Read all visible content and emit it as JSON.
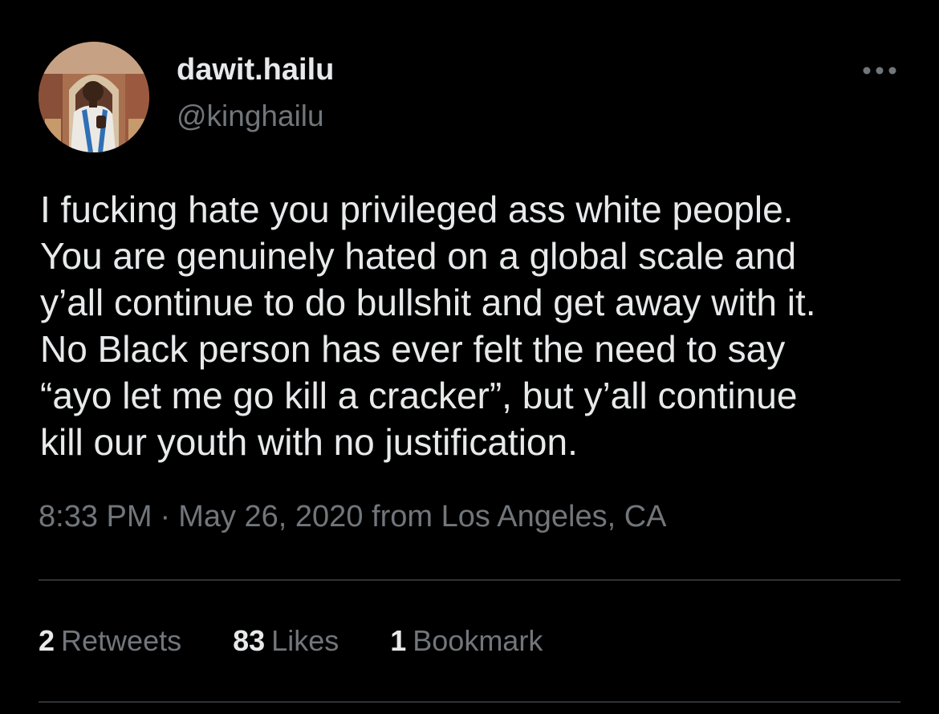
{
  "author": {
    "display_name": "dawit.hailu",
    "handle": "@kinghailu",
    "avatar_icon": "profile-photo"
  },
  "more_icon": "more-horizontal-icon",
  "tweet": {
    "lines": [
      "I fucking hate you privileged ass white people.",
      "You are genuinely hated on a global scale and",
      "y’all continue to do bullshit and get away with it.",
      "No Black person has ever felt the need to say",
      "“ayo let me go kill a cracker”, but y’all continue",
      "kill our youth with no justification."
    ]
  },
  "meta": {
    "time": "8:33 PM",
    "separator": "·",
    "date": "May 26, 2020",
    "location": "from Los Angeles, CA"
  },
  "stats": {
    "retweets_count": "2",
    "retweets_label": "Retweets",
    "likes_count": "83",
    "likes_label": "Likes",
    "bookmarks_count": "1",
    "bookmarks_label": "Bookmark"
  },
  "colors": {
    "background": "#000000",
    "primary_text": "#e7e9ea",
    "secondary_text": "#71767b",
    "divider": "#2f3336"
  }
}
